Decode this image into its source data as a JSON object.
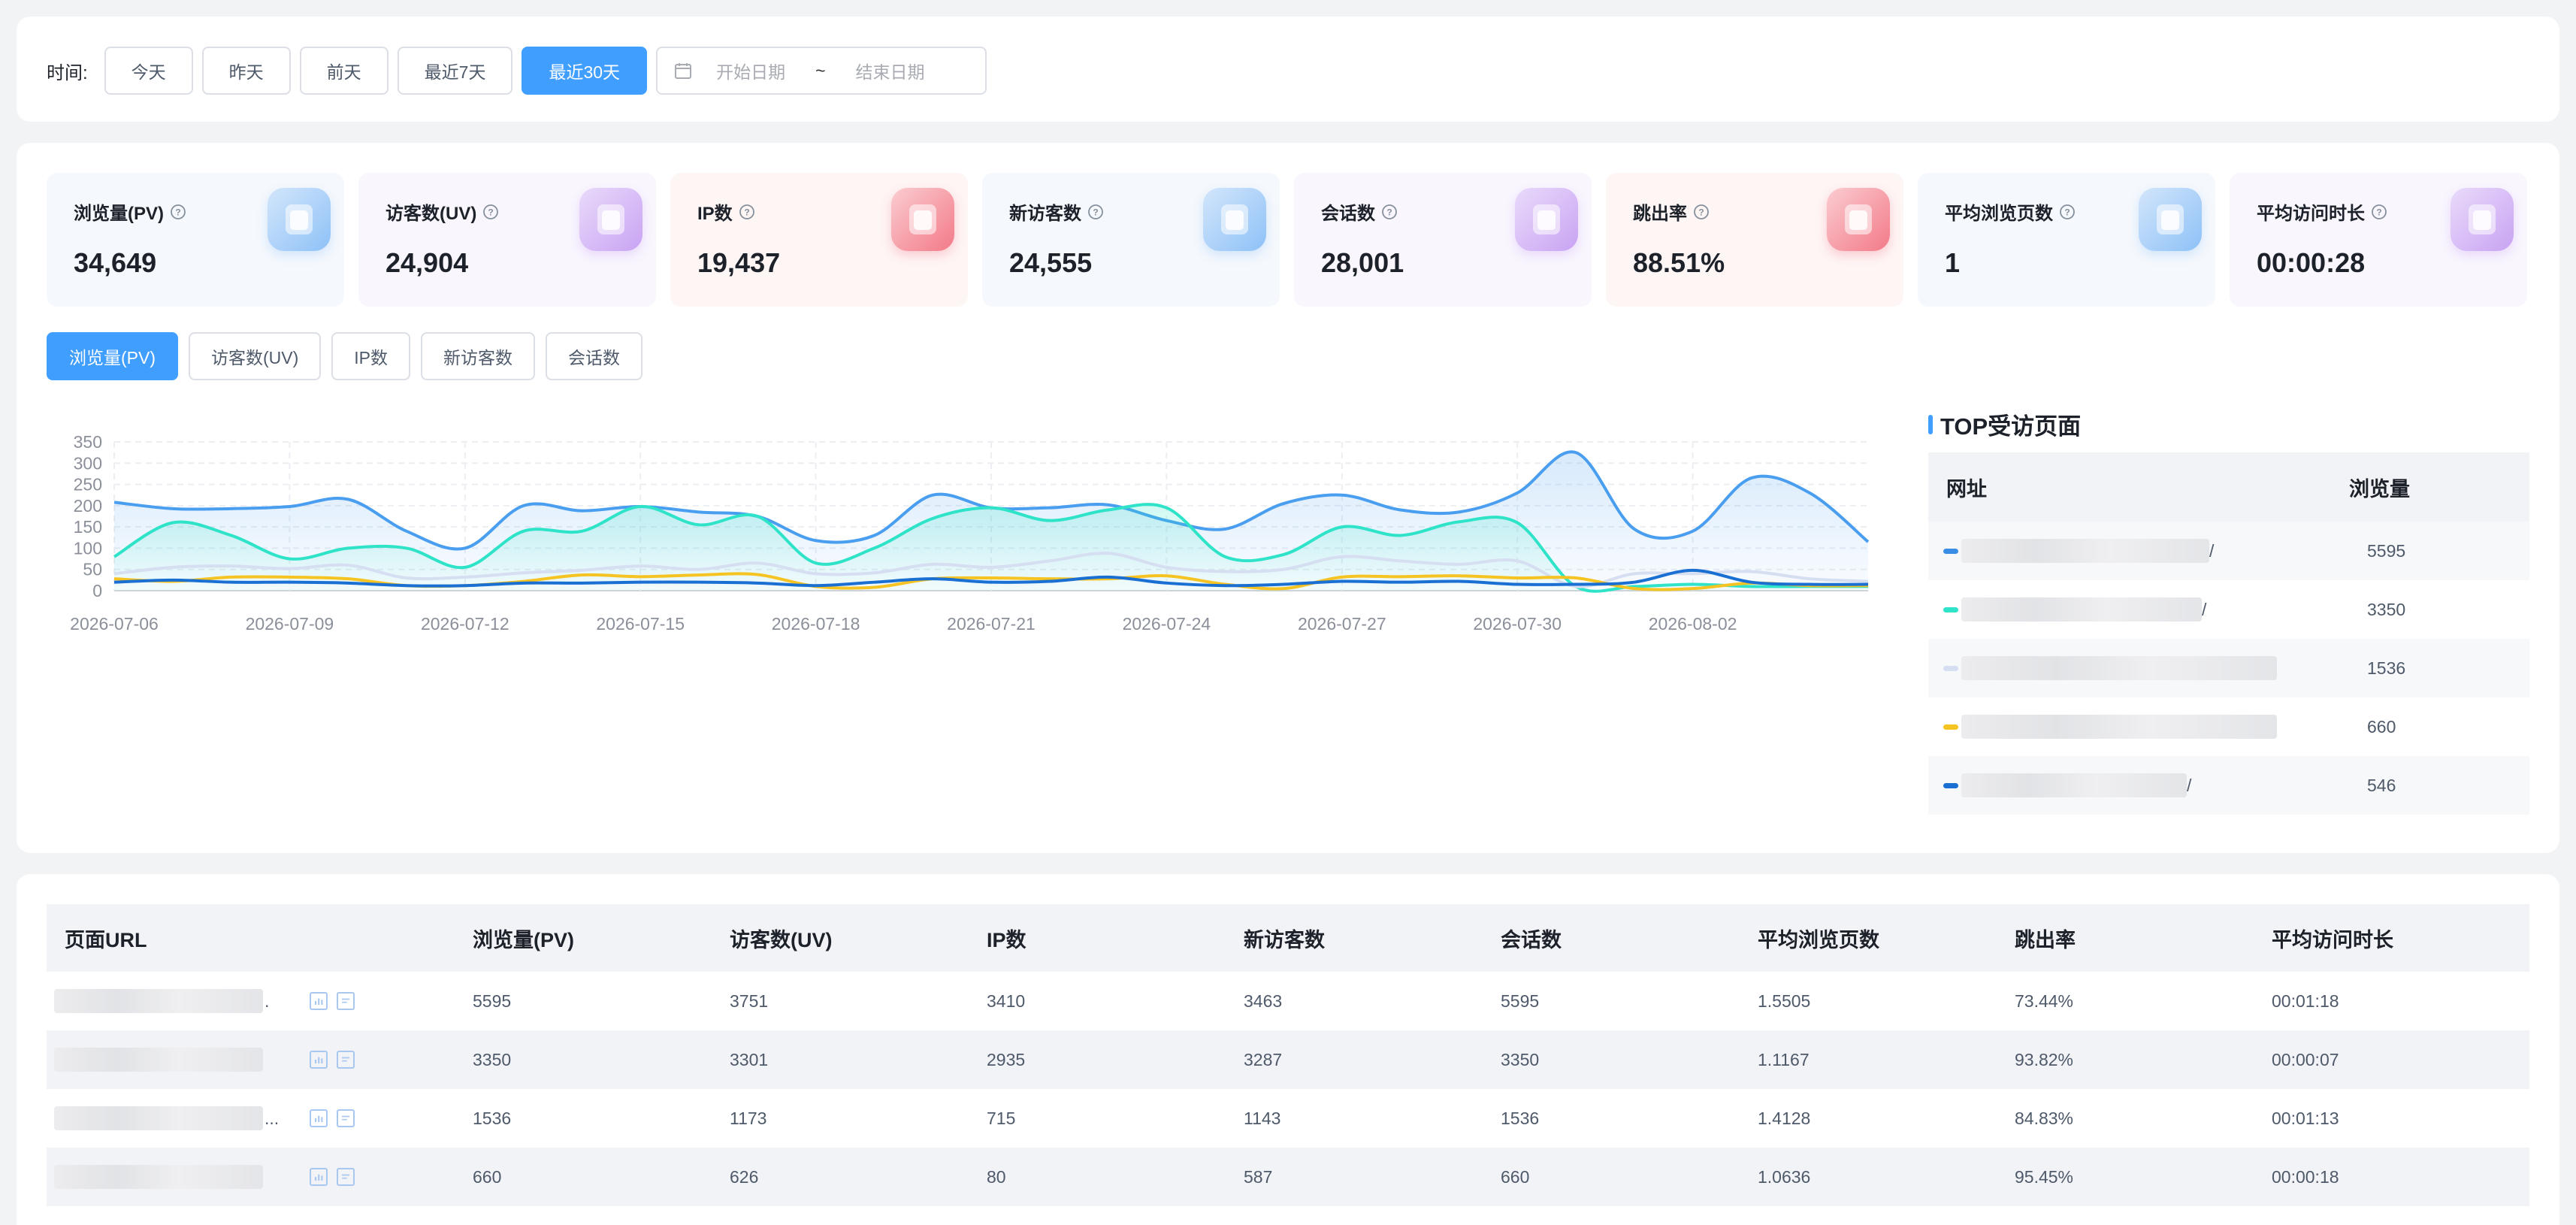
{
  "filter": {
    "label": "时间:",
    "ranges": [
      "今天",
      "昨天",
      "前天",
      "最近7天",
      "最近30天"
    ],
    "active_range": "最近30天",
    "start_placeholder": "开始日期",
    "separator": "~",
    "end_placeholder": "结束日期"
  },
  "metrics": [
    {
      "title": "浏览量(PV)",
      "value": "34,649",
      "bg": "#f5f8fd",
      "icon_color": "#8ec1f7"
    },
    {
      "title": "访客数(UV)",
      "value": "24,904",
      "bg": "#f9f6fe",
      "icon_color": "#c9a3f3"
    },
    {
      "title": "IP数",
      "value": "19,437",
      "bg": "#fef5f5",
      "icon_color": "#f37a88"
    },
    {
      "title": "新访客数",
      "value": "24,555",
      "bg": "#f5f8fd",
      "icon_color": "#8ec1f7"
    },
    {
      "title": "会话数",
      "value": "28,001",
      "bg": "#f9f6fe",
      "icon_color": "#c9a3f3"
    },
    {
      "title": "跳出率",
      "value": "88.51%",
      "bg": "#fef5f5",
      "icon_color": "#f37a88"
    },
    {
      "title": "平均浏览页数",
      "value": "1",
      "bg": "#f5f8fd",
      "icon_color": "#8ec1f7"
    },
    {
      "title": "平均访问时长",
      "value": "00:00:28",
      "bg": "#f9f6fe",
      "icon_color": "#c9a3f3"
    }
  ],
  "chart_tabs": [
    "浏览量(PV)",
    "访客数(UV)",
    "IP数",
    "新访客数",
    "会话数"
  ],
  "chart_data": {
    "type": "line",
    "x": [
      "2026-07-06",
      "2026-07-07",
      "2026-07-08",
      "2026-07-09",
      "2026-07-10",
      "2026-07-11",
      "2026-07-12",
      "2026-07-13",
      "2026-07-14",
      "2026-07-15",
      "2026-07-16",
      "2026-07-17",
      "2026-07-18",
      "2026-07-19",
      "2026-07-20",
      "2026-07-21",
      "2026-07-22",
      "2026-07-23",
      "2026-07-24",
      "2026-07-25",
      "2026-07-26",
      "2026-07-27",
      "2026-07-28",
      "2026-07-29",
      "2026-07-30",
      "2026-07-31",
      "2026-08-01",
      "2026-08-02",
      "2026-08-03",
      "2026-08-04",
      "2026-08-05"
    ],
    "xticks": [
      "2026-07-06",
      "2026-07-09",
      "2026-07-12",
      "2026-07-15",
      "2026-07-18",
      "2026-07-21",
      "2026-07-24",
      "2026-07-27",
      "2026-07-30",
      "2026-08-02"
    ],
    "yticks": [
      0,
      50,
      100,
      150,
      200,
      250,
      300,
      350
    ],
    "ylim": [
      0,
      350
    ],
    "grid": true,
    "series": [
      {
        "color": "#4a9eef",
        "fill": true,
        "values": [
          208,
          193,
          193,
          198,
          215,
          140,
          100,
          200,
          188,
          198,
          185,
          175,
          118,
          130,
          225,
          195,
          195,
          202,
          165,
          145,
          205,
          225,
          190,
          185,
          230,
          325,
          145,
          140,
          265,
          230,
          115
        ]
      },
      {
        "color": "#2ee3c8",
        "fill": true,
        "values": [
          80,
          160,
          130,
          75,
          100,
          100,
          55,
          140,
          140,
          198,
          155,
          175,
          65,
          100,
          170,
          195,
          165,
          190,
          195,
          80,
          85,
          150,
          130,
          162,
          160,
          10,
          10,
          15,
          10,
          10,
          10
        ]
      },
      {
        "color": "#d6def1",
        "fill": false,
        "values": [
          40,
          55,
          58,
          52,
          60,
          30,
          32,
          42,
          48,
          58,
          50,
          65,
          40,
          42,
          62,
          55,
          70,
          88,
          55,
          45,
          50,
          80,
          70,
          62,
          70,
          10,
          40,
          40,
          45,
          28,
          22
        ]
      },
      {
        "color": "#f5c322",
        "fill": false,
        "values": [
          28,
          22,
          32,
          32,
          28,
          12,
          12,
          22,
          37,
          33,
          37,
          38,
          10,
          8,
          28,
          30,
          28,
          28,
          35,
          15,
          5,
          32,
          33,
          35,
          30,
          30,
          5,
          5,
          18,
          12,
          12
        ]
      },
      {
        "color": "#1a6fd3",
        "fill": false,
        "values": [
          20,
          25,
          20,
          20,
          18,
          12,
          12,
          18,
          18,
          20,
          20,
          18,
          12,
          20,
          28,
          20,
          22,
          32,
          18,
          12,
          15,
          22,
          20,
          22,
          15,
          15,
          20,
          48,
          20,
          15,
          15
        ]
      }
    ]
  },
  "top_pages": {
    "title": "TOP受访页面",
    "col_url": "网址",
    "col_pv": "浏览量",
    "rows": [
      {
        "pv": "5595",
        "color": "#3a8ee6",
        "tail": "/"
      },
      {
        "pv": "3350",
        "color": "#2ee3c8",
        "tail": "/"
      },
      {
        "pv": "1536",
        "color": "#d6def1",
        "tail": ""
      },
      {
        "pv": "660",
        "color": "#f5c322",
        "tail": ""
      },
      {
        "pv": "546",
        "color": "#1a6fd3",
        "tail": "/"
      }
    ]
  },
  "detail_table": {
    "headers": [
      "页面URL",
      "浏览量(PV)",
      "访客数(UV)",
      "IP数",
      "新访客数",
      "会话数",
      "平均浏览页数",
      "跳出率",
      "平均访问时长"
    ],
    "rows": [
      {
        "url_suffix": ".",
        "cells": [
          "5595",
          "3751",
          "3410",
          "3463",
          "5595",
          "1.5505",
          "73.44%",
          "00:01:18"
        ]
      },
      {
        "url_suffix": "",
        "cells": [
          "3350",
          "3301",
          "2935",
          "3287",
          "3350",
          "1.1167",
          "93.82%",
          "00:00:07"
        ]
      },
      {
        "url_suffix": "...",
        "cells": [
          "1536",
          "1173",
          "715",
          "1143",
          "1536",
          "1.4128",
          "84.83%",
          "00:01:13"
        ]
      },
      {
        "url_suffix": "",
        "cells": [
          "660",
          "626",
          "80",
          "587",
          "660",
          "1.0636",
          "95.45%",
          "00:00:18"
        ]
      }
    ]
  }
}
